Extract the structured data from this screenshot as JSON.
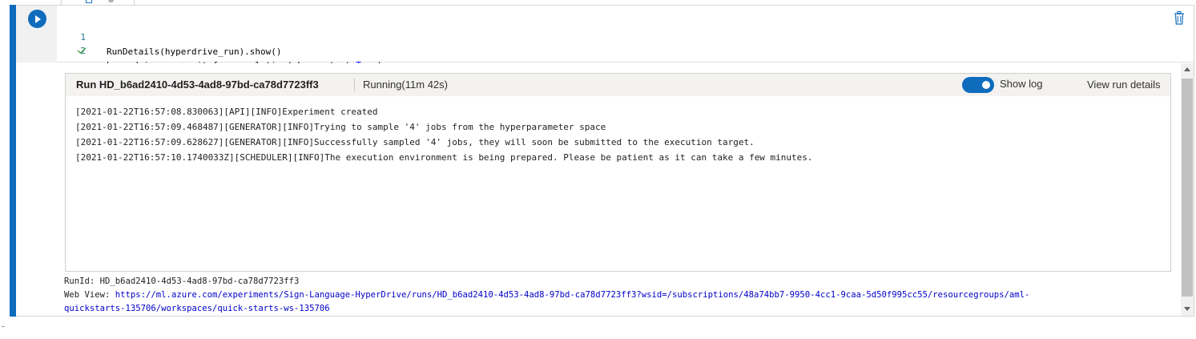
{
  "cell": {
    "code_lines": [
      {
        "number": "1",
        "text": "RunDetails(hyperdrive_run).show()"
      },
      {
        "number": "2",
        "text_before": "hyperdrive_run.wait_for_completion(show_output=",
        "keyword": "True",
        "text_after": ")"
      }
    ],
    "status_icon": "checkmark-icon",
    "run_icon": "play-icon",
    "delete_icon": "trash-icon"
  },
  "widget": {
    "title": "Run HD_b6ad2410-4d53-4ad8-97bd-ca78d7723ff3",
    "status": "Running(11m 42s)",
    "toggle_label": "Show log",
    "toggle_on": true,
    "view_details_label": "View run details",
    "log_lines": [
      "[2021-01-22T16:57:08.830063][API][INFO]Experiment created",
      "[2021-01-22T16:57:09.468487][GENERATOR][INFO]Trying to sample '4' jobs from the hyperparameter space",
      "[2021-01-22T16:57:09.628627][GENERATOR][INFO]Successfully sampled '4' jobs, they will soon be submitted to the execution target.",
      "[2021-01-22T16:57:10.1740033Z][SCHEDULER][INFO]The execution environment is being prepared. Please be patient as it can take a few minutes."
    ]
  },
  "output": {
    "run_id_label": "RunId: ",
    "run_id": "HD_b6ad2410-4d53-4ad8-97bd-ca78d7723ff3",
    "web_view_label": "Web View: ",
    "web_view_url_part1": "https://ml.azure.com/experiments/Sign-Language-HyperDrive/runs/HD_b6ad2410-4d53-4ad8-97bd-ca78d7723ff3?wsid=/subscriptions/48a74bb7-9950-4cc1-9caa-5d50f995cc55/resourcegroups/aml-",
    "web_view_url_part2": "quickstarts-135706/workspaces/quick-starts-ws-135706"
  },
  "colors": {
    "accent": "#0f6cbd",
    "link": "#0000c8",
    "check": "#3a9a3a",
    "keyword": "#0000ff"
  }
}
